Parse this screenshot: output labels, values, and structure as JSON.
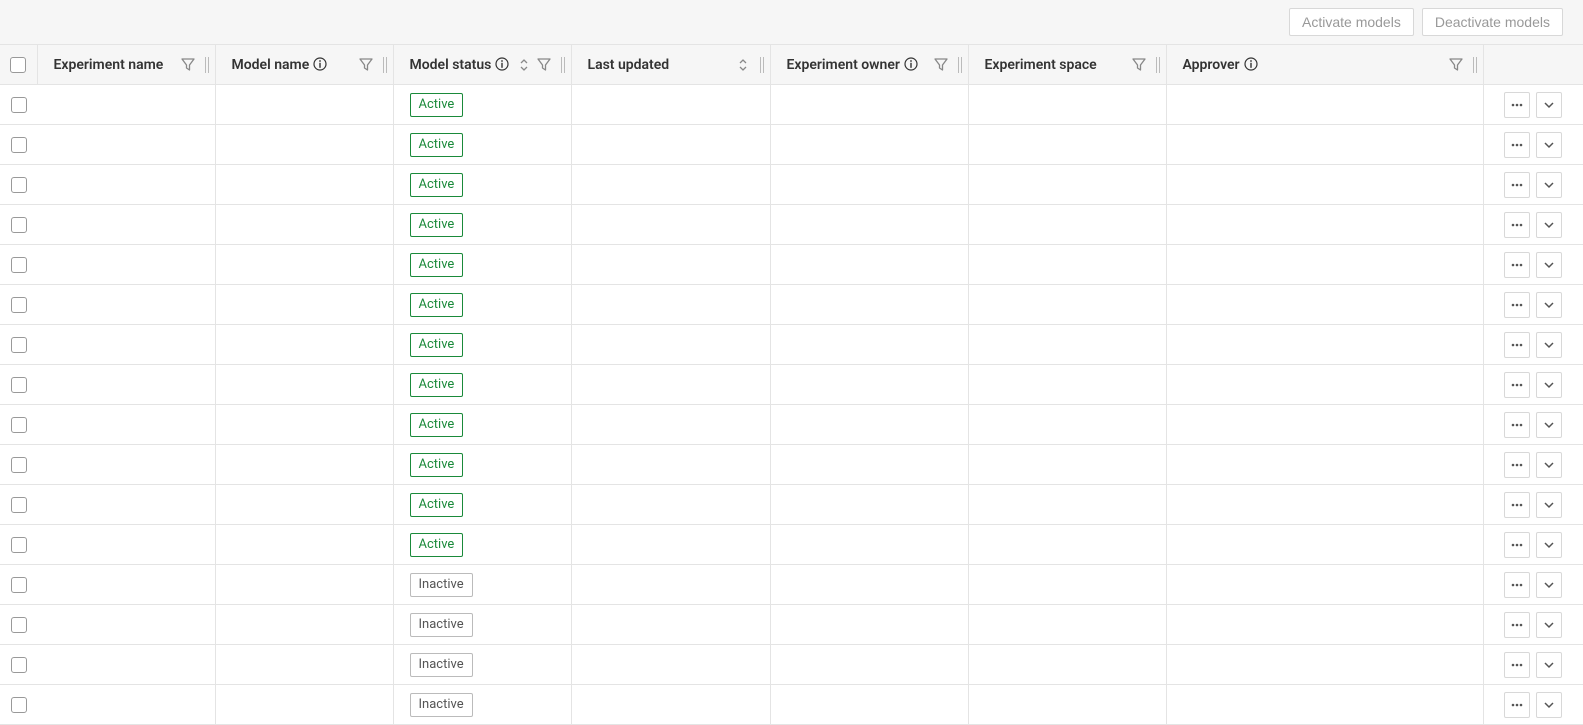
{
  "toolbar": {
    "activate_label": "Activate models",
    "deactivate_label": "Deactivate models"
  },
  "columns": {
    "experiment_name": "Experiment name",
    "model_name": "Model name",
    "model_status": "Model status",
    "last_updated": "Last updated",
    "experiment_owner": "Experiment owner",
    "experiment_space": "Experiment space",
    "approver": "Approver"
  },
  "status_labels": {
    "active": "Active",
    "inactive": "Inactive"
  },
  "rows": [
    {
      "status": "active"
    },
    {
      "status": "active"
    },
    {
      "status": "active"
    },
    {
      "status": "active"
    },
    {
      "status": "active"
    },
    {
      "status": "active"
    },
    {
      "status": "active"
    },
    {
      "status": "active"
    },
    {
      "status": "active"
    },
    {
      "status": "active"
    },
    {
      "status": "active"
    },
    {
      "status": "active"
    },
    {
      "status": "inactive"
    },
    {
      "status": "inactive"
    },
    {
      "status": "inactive"
    },
    {
      "status": "inactive"
    }
  ],
  "colors": {
    "active_badge": "#1a8a3a",
    "inactive_badge": "#555555",
    "header_bg": "#f6f6f6",
    "border": "#e4e4e4"
  }
}
